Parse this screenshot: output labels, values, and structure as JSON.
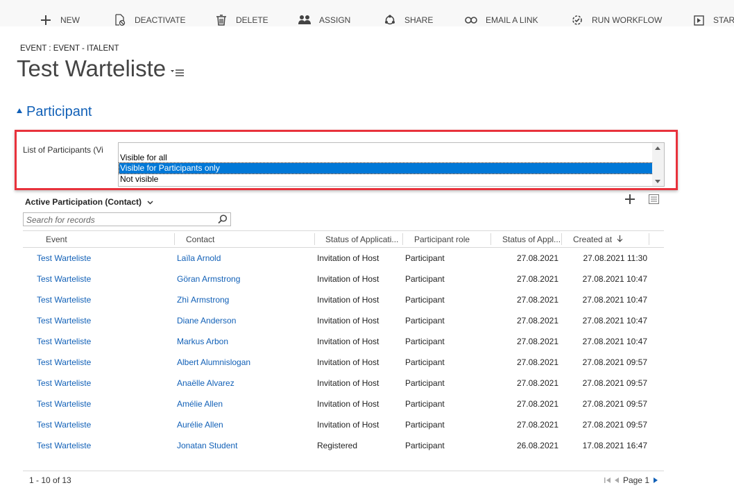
{
  "commands": [
    {
      "label": "NEW",
      "icon": "plus-icon"
    },
    {
      "label": "DEACTIVATE",
      "icon": "deactivate-icon"
    },
    {
      "label": "DELETE",
      "icon": "trash-icon"
    },
    {
      "label": "ASSIGN",
      "icon": "assign-people-icon"
    },
    {
      "label": "SHARE",
      "icon": "share-icon"
    },
    {
      "label": "EMAIL A LINK",
      "icon": "link-icon"
    },
    {
      "label": "RUN WORKFLOW",
      "icon": "workflow-icon"
    },
    {
      "label": "START",
      "icon": "start-dialog-icon"
    }
  ],
  "header": {
    "entity": "EVENT : EVENT - ITALENT",
    "title": "Test Warteliste"
  },
  "section": {
    "title": "Participant"
  },
  "field": {
    "label": "List of Participants (Vi",
    "options": [
      "Visible for all",
      "Visible for Participants only",
      "Not visible"
    ],
    "selected": "Visible for Participants only"
  },
  "grid": {
    "view_title": "Active Participation (Contact)",
    "search_placeholder": "Search for records",
    "columns": [
      "Event",
      "Contact",
      "Status of Applicati...",
      "Participant role",
      "Status of Appl...",
      "Created at"
    ],
    "sort_icon": "arrow-down-icon",
    "rows": [
      {
        "event": "Test Warteliste",
        "contact": "Laïla Arnold",
        "status": "Invitation of Host",
        "role": "Participant",
        "status_date": "27.08.2021",
        "created": "27.08.2021 11:30"
      },
      {
        "event": "Test Warteliste",
        "contact": "Göran Armstrong",
        "status": "Invitation of Host",
        "role": "Participant",
        "status_date": "27.08.2021",
        "created": "27.08.2021 10:47"
      },
      {
        "event": "Test Warteliste",
        "contact": "Zhì Armstrong",
        "status": "Invitation of Host",
        "role": "Participant",
        "status_date": "27.08.2021",
        "created": "27.08.2021 10:47"
      },
      {
        "event": "Test Warteliste",
        "contact": "Diane Anderson",
        "status": "Invitation of Host",
        "role": "Participant",
        "status_date": "27.08.2021",
        "created": "27.08.2021 10:47"
      },
      {
        "event": "Test Warteliste",
        "contact": "Markus Arbon",
        "status": "Invitation of Host",
        "role": "Participant",
        "status_date": "27.08.2021",
        "created": "27.08.2021 10:47"
      },
      {
        "event": "Test Warteliste",
        "contact": "Albert Alumnislogan",
        "status": "Invitation of Host",
        "role": "Participant",
        "status_date": "27.08.2021",
        "created": "27.08.2021 09:57"
      },
      {
        "event": "Test Warteliste",
        "contact": "Anaëlle Alvarez",
        "status": "Invitation of Host",
        "role": "Participant",
        "status_date": "27.08.2021",
        "created": "27.08.2021 09:57"
      },
      {
        "event": "Test Warteliste",
        "contact": "Amélie Allen",
        "status": "Invitation of Host",
        "role": "Participant",
        "status_date": "27.08.2021",
        "created": "27.08.2021 09:57"
      },
      {
        "event": "Test Warteliste",
        "contact": "Aurélie Allen",
        "status": "Invitation of Host",
        "role": "Participant",
        "status_date": "27.08.2021",
        "created": "27.08.2021 09:57"
      },
      {
        "event": "Test Warteliste",
        "contact": "Jonatan Student",
        "status": "Registered",
        "role": "Participant",
        "status_date": "26.08.2021",
        "created": "17.08.2021 16:47"
      }
    ],
    "record_count": "1 - 10 of 13",
    "page_label": "Page 1"
  },
  "colors": {
    "accent": "#1160b7",
    "highlight": "#e8323c",
    "selection": "#0078d7"
  }
}
